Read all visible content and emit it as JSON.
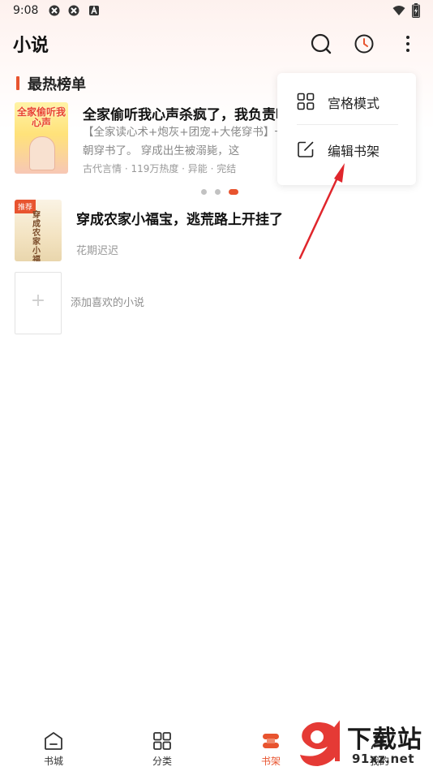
{
  "status_bar": {
    "time": "9:08"
  },
  "header": {
    "title": "小说"
  },
  "section": {
    "title": "最热榜单"
  },
  "hot_book": {
    "cover_text": "全家偷听我心声",
    "title": "全家偷听我心声杀疯了，我负责吃奶",
    "description": "【全家读心术+炮灰+团宠+大佬穿书】一朝穿书了。    穿成出生被溺毙，这",
    "meta": "古代言情 · 119万热度 · 异能 · 完结"
  },
  "carousel": {
    "count": 3,
    "active_index": 2
  },
  "shelf_book": {
    "tag": "推荐",
    "cover_text": "穿成农家小福宝",
    "title": "穿成农家小福宝，逃荒路上开挂了",
    "author": "花期迟迟"
  },
  "add_book": {
    "plus": "+",
    "label": "添加喜欢的小说"
  },
  "popup": {
    "items": [
      {
        "label": "宫格模式",
        "icon": "grid-icon"
      },
      {
        "label": "编辑书架",
        "icon": "edit-icon"
      }
    ]
  },
  "bottom_nav": {
    "tabs": [
      {
        "label": "书城",
        "icon": "home-icon"
      },
      {
        "label": "分类",
        "icon": "category-icon"
      },
      {
        "label": "书架",
        "icon": "bookshelf-icon",
        "active": true
      },
      {
        "label": "我的",
        "icon": "profile-icon"
      }
    ]
  },
  "watermark": {
    "text1": "下载站",
    "text2": "91xz.net",
    "logo": "9"
  },
  "colors": {
    "accent": "#e8542f",
    "arrow": "#e0262c"
  }
}
